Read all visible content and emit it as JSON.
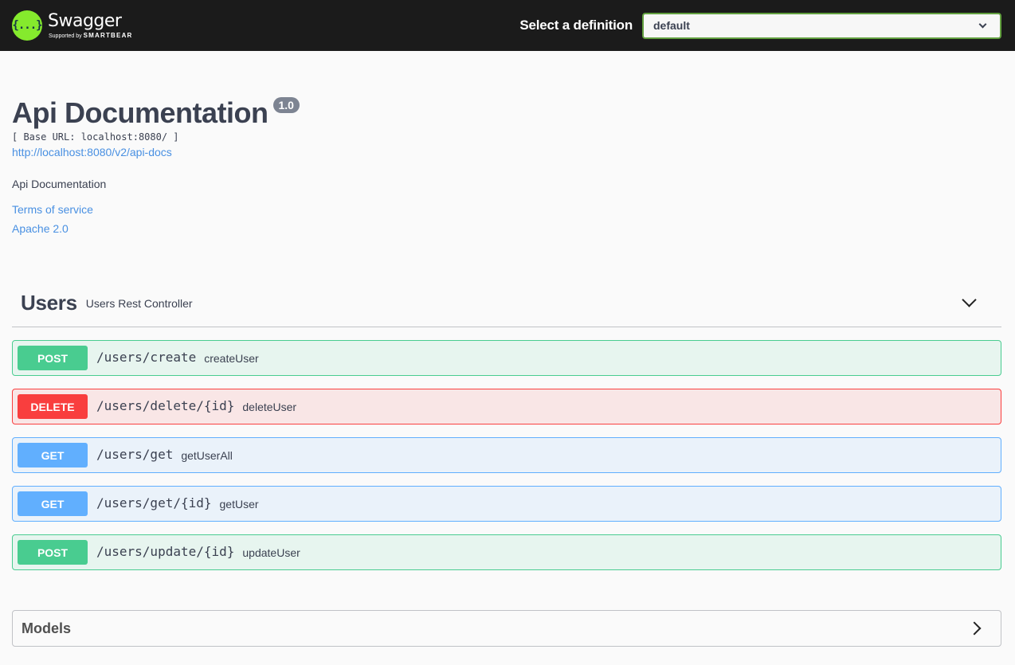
{
  "topbar": {
    "logo_name": "Swagger",
    "logo_symbol": "{...}",
    "logo_sub_prefix": "Supported by",
    "logo_sub_brand": "SMARTBEAR",
    "select_label": "Select a definition",
    "select_value": "default",
    "accent_color": "#85ea2d"
  },
  "info": {
    "title": "Api Documentation",
    "version": "1.0",
    "base_url": "[ Base URL: localhost:8080/ ]",
    "docs_link": "http://localhost:8080/v2/api-docs",
    "description": "Api Documentation",
    "terms_link": "Terms of service",
    "license_link": "Apache 2.0"
  },
  "tag": {
    "name": "Users",
    "description": "Users Rest Controller",
    "operations": [
      {
        "method": "POST",
        "path": "/users/create",
        "summary": "createUser"
      },
      {
        "method": "DELETE",
        "path": "/users/delete/{id}",
        "summary": "deleteUser"
      },
      {
        "method": "GET",
        "path": "/users/get",
        "summary": "getUserAll"
      },
      {
        "method": "GET",
        "path": "/users/get/{id}",
        "summary": "getUser"
      },
      {
        "method": "POST",
        "path": "/users/update/{id}",
        "summary": "updateUser"
      }
    ]
  },
  "models": {
    "title": "Models"
  },
  "method_colors": {
    "POST": "#49cc90",
    "DELETE": "#f93e3e",
    "GET": "#61affe"
  }
}
